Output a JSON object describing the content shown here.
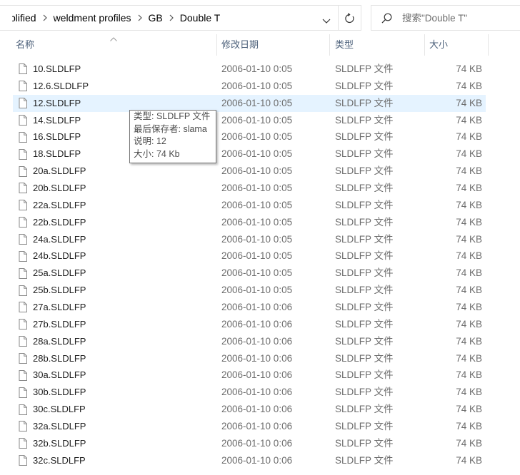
{
  "address_bar": {
    "breadcrumb": [
      {
        "label": "plified"
      },
      {
        "label": "weldment profiles"
      },
      {
        "label": "GB"
      },
      {
        "label": "Double T"
      }
    ]
  },
  "search": {
    "placeholder": "搜索\"Double T\""
  },
  "columns": {
    "name": "名称",
    "modified": "修改日期",
    "type": "类型",
    "size": "大小"
  },
  "files": [
    {
      "name": "10.SLDLFP",
      "modified": "2006-01-10 0:05",
      "type": "SLDLFP 文件",
      "size": "74 KB"
    },
    {
      "name": "12.6.SLDLFP",
      "modified": "2006-01-10 0:05",
      "type": "SLDLFP 文件",
      "size": "74 KB"
    },
    {
      "name": "12.SLDLFP",
      "modified": "2006-01-10 0:05",
      "type": "SLDLFP 文件",
      "size": "74 KB",
      "hovered": true
    },
    {
      "name": "14.SLDLFP",
      "modified": "2006-01-10 0:05",
      "type": "SLDLFP 文件",
      "size": "74 KB"
    },
    {
      "name": "16.SLDLFP",
      "modified": "2006-01-10 0:05",
      "type": "SLDLFP 文件",
      "size": "74 KB"
    },
    {
      "name": "18.SLDLFP",
      "modified": "2006-01-10 0:05",
      "type": "SLDLFP 文件",
      "size": "74 KB"
    },
    {
      "name": "20a.SLDLFP",
      "modified": "2006-01-10 0:05",
      "type": "SLDLFP 文件",
      "size": "74 KB"
    },
    {
      "name": "20b.SLDLFP",
      "modified": "2006-01-10 0:05",
      "type": "SLDLFP 文件",
      "size": "74 KB"
    },
    {
      "name": "22a.SLDLFP",
      "modified": "2006-01-10 0:05",
      "type": "SLDLFP 文件",
      "size": "74 KB"
    },
    {
      "name": "22b.SLDLFP",
      "modified": "2006-01-10 0:05",
      "type": "SLDLFP 文件",
      "size": "74 KB"
    },
    {
      "name": "24a.SLDLFP",
      "modified": "2006-01-10 0:05",
      "type": "SLDLFP 文件",
      "size": "74 KB"
    },
    {
      "name": "24b.SLDLFP",
      "modified": "2006-01-10 0:05",
      "type": "SLDLFP 文件",
      "size": "74 KB"
    },
    {
      "name": "25a.SLDLFP",
      "modified": "2006-01-10 0:05",
      "type": "SLDLFP 文件",
      "size": "74 KB"
    },
    {
      "name": "25b.SLDLFP",
      "modified": "2006-01-10 0:05",
      "type": "SLDLFP 文件",
      "size": "74 KB"
    },
    {
      "name": "27a.SLDLFP",
      "modified": "2006-01-10 0:06",
      "type": "SLDLFP 文件",
      "size": "74 KB"
    },
    {
      "name": "27b.SLDLFP",
      "modified": "2006-01-10 0:06",
      "type": "SLDLFP 文件",
      "size": "74 KB"
    },
    {
      "name": "28a.SLDLFP",
      "modified": "2006-01-10 0:06",
      "type": "SLDLFP 文件",
      "size": "74 KB"
    },
    {
      "name": "28b.SLDLFP",
      "modified": "2006-01-10 0:06",
      "type": "SLDLFP 文件",
      "size": "74 KB"
    },
    {
      "name": "30a.SLDLFP",
      "modified": "2006-01-10 0:06",
      "type": "SLDLFP 文件",
      "size": "74 KB"
    },
    {
      "name": "30b.SLDLFP",
      "modified": "2006-01-10 0:06",
      "type": "SLDLFP 文件",
      "size": "74 KB"
    },
    {
      "name": "30c.SLDLFP",
      "modified": "2006-01-10 0:06",
      "type": "SLDLFP 文件",
      "size": "74 KB"
    },
    {
      "name": "32a.SLDLFP",
      "modified": "2006-01-10 0:06",
      "type": "SLDLFP 文件",
      "size": "74 KB"
    },
    {
      "name": "32b.SLDLFP",
      "modified": "2006-01-10 0:06",
      "type": "SLDLFP 文件",
      "size": "74 KB"
    },
    {
      "name": "32c.SLDLFP",
      "modified": "2006-01-10 0:06",
      "type": "SLDLFP 文件",
      "size": "74 KB"
    }
  ],
  "tooltip": {
    "type": "类型: SLDLFP 文件",
    "author": "最后保存者: slama",
    "comment": "说明: 12",
    "size": "大小: 74 Kb"
  },
  "icons": {
    "breadcrumb_separator": "chevron-right-icon",
    "address_dropdown": "chevron-down-icon",
    "refresh": "refresh-icon",
    "search": "search-icon",
    "sort": "sort-ascending-icon",
    "file": "file-icon"
  },
  "colors": {
    "hover_background": "#e5f3ff",
    "header_text": "#4c607a",
    "secondary_text": "#6d6d6d",
    "primary_text": "#1e1e1e"
  }
}
